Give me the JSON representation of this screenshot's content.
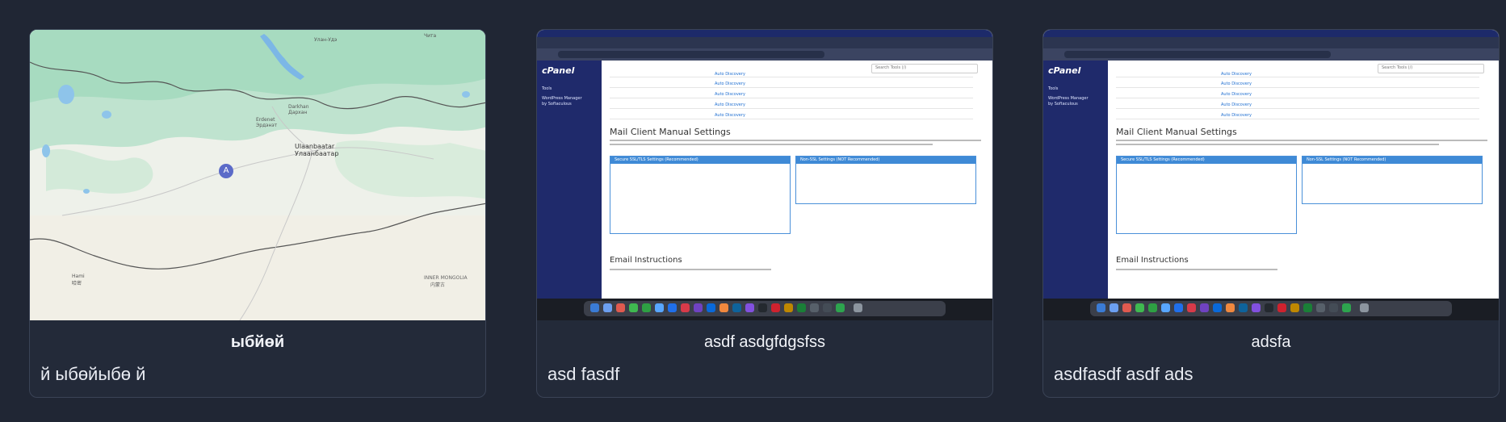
{
  "cards": [
    {
      "title": "ыбйөй",
      "description": "й ыбөйыбө й",
      "thumbnail": {
        "type": "map",
        "labels": {
          "city_en": "Ulaanbaatar",
          "city_mn": "Улаанбаатар",
          "darkhan_en": "Darkhan",
          "darkhan_mn": "Дархан",
          "erdenet_en": "Erdenet",
          "erdenet_mn": "Эрдэнэт",
          "khovd_en": "Hami",
          "khovd_cn": "哈密",
          "inner_mongolia": "INNER MONGOLIA",
          "inner_mongolia_cn": "内蒙古",
          "ulan_ude": "Улан-Удэ",
          "chita": "Чита",
          "marker": "A"
        }
      }
    },
    {
      "title": "asdf asdgfdgsfss",
      "description": "asd fasdf",
      "thumbnail": {
        "type": "screenshot",
        "sidebar_logo": "cPanel",
        "sidebar_items": [
          "Tools",
          "WordPress Manager",
          "by Softaculous"
        ],
        "search_placeholder": "Search Tools (/)",
        "heading_main": "Mail Client Manual Settings",
        "heading_email": "Email Instructions",
        "panel_left": "Secure SSL/TLS Settings (Recommended)",
        "panel_right": "Non-SSL Settings (NOT Recommended)",
        "autodiscovery": "Auto Discovery"
      }
    },
    {
      "title": "adsfa",
      "description": "asdfasdf asdf ads",
      "thumbnail": {
        "type": "screenshot",
        "sidebar_logo": "cPanel",
        "sidebar_items": [
          "Tools",
          "WordPress Manager",
          "by Softaculous"
        ],
        "search_placeholder": "Search Tools (/)",
        "heading_main": "Mail Client Manual Settings",
        "heading_email": "Email Instructions",
        "panel_left": "Secure SSL/TLS Settings (Recommended)",
        "panel_right": "Non-SSL Settings (NOT Recommended)",
        "autodiscovery": "Auto Discovery"
      }
    }
  ],
  "colors": {
    "page_bg": "#202634",
    "card_bg": "#232a39",
    "card_border": "#3a4356",
    "marker": "#5b6bc8",
    "cpanel_sidebar": "#1f2a6b",
    "panel_header": "#3f8ad6"
  }
}
